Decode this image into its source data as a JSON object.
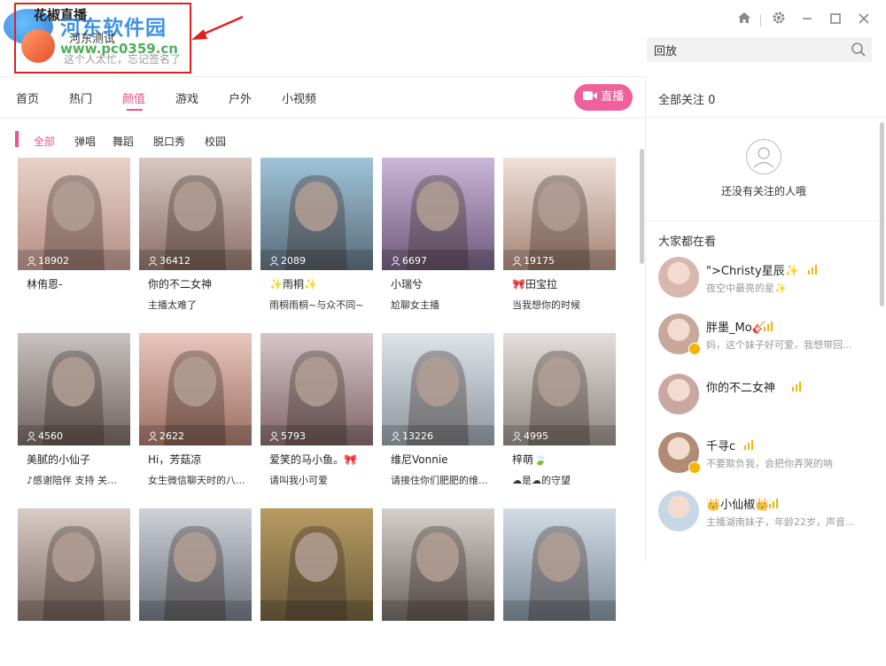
{
  "header": {
    "app_title": "花椒直播",
    "nickname": "河东测试",
    "signature": "这个人太忙，忘记签名了",
    "watermark_text": "河东软件园",
    "watermark_url": "www.pc0359.cn",
    "annotation_color": "#e02020"
  },
  "search": {
    "value": "回放"
  },
  "nav": {
    "tabs": [
      "首页",
      "热门",
      "颜值",
      "游戏",
      "户外",
      "小视频"
    ],
    "active_index": 2,
    "live_button": "直播"
  },
  "categories": {
    "items": [
      "全部",
      "弹唱",
      "舞蹈",
      "脱口秀",
      "校园"
    ],
    "active_index": 0
  },
  "cards": [
    {
      "viewers": "18902",
      "title": "林侑恩-",
      "desc": ""
    },
    {
      "viewers": "36412",
      "title": "你的不二女神",
      "desc": "主播太难了"
    },
    {
      "viewers": "2089",
      "title": "✨雨桐✨",
      "desc": "雨桐雨桐~与众不同~"
    },
    {
      "viewers": "6697",
      "title": "小瑞兮",
      "desc": "尬聊女主播"
    },
    {
      "viewers": "19175",
      "title": "🎀田宝拉",
      "desc": "当我想你的时候"
    },
    {
      "viewers": "4560",
      "title": "美腻的小仙子",
      "desc": "♪感谢陪伴 支持 关心..."
    },
    {
      "viewers": "2622",
      "title": "Hi，芳菇凉",
      "desc": "女生微信聊天时的八..."
    },
    {
      "viewers": "5793",
      "title": "爱笑的马小鱼。🎀",
      "desc": "请叫我小可爱"
    },
    {
      "viewers": "13226",
      "title": "维尼Vonnie",
      "desc": "请接住你们肥肥的维..."
    },
    {
      "viewers": "4995",
      "title": "梓萌🍃",
      "desc": "☁是☁的守望"
    },
    {
      "viewers": "",
      "title": "",
      "desc": ""
    },
    {
      "viewers": "",
      "title": "",
      "desc": ""
    },
    {
      "viewers": "",
      "title": "",
      "desc": ""
    },
    {
      "viewers": "",
      "title": "",
      "desc": ""
    },
    {
      "viewers": "",
      "title": "",
      "desc": ""
    }
  ],
  "right_panel": {
    "follow_count": "全部关注 0",
    "empty_text": "还没有关注的人哦",
    "everyone_title": "大家都在看",
    "users": [
      {
        "name": "\">Christy星辰✨",
        "desc": "夜空中最亮的星✨"
      },
      {
        "name": "胖墨_Mo🎸",
        "desc": "妈，这个妹子好可爱，我想带回..."
      },
      {
        "name": "你的不二女神",
        "desc": ""
      },
      {
        "name": "千寻c",
        "desc": "不要欺负我，会把你弄哭的呐"
      },
      {
        "name": "👑小仙椒👑",
        "desc": "主播湖南妹子，年龄22岁，声音..."
      }
    ]
  },
  "colors": {
    "accent": "#f0508c",
    "live_button": "#f0609a"
  }
}
